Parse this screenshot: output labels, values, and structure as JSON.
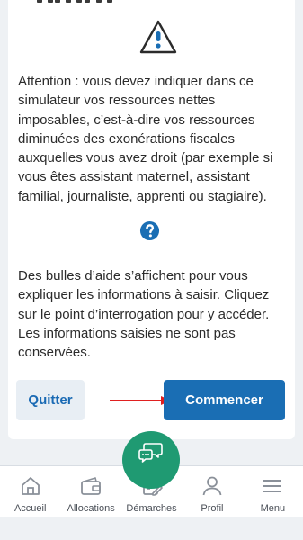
{
  "warning_text": "Attention : vous devez indiquer dans ce simulateur vos ressources nettes imposables, c’est-à-dire vos ressources diminuées des exonérations fiscales auxquelles vous avez droit (par exemple si vous êtes assistant maternel, assistant familial, journaliste, apprenti ou stagiaire).",
  "help_text_line1": "Des bulles d’aide s’affichent pour vous expliquer les informations à saisir. Cliquez sur le point d’interrogation pour y accéder.",
  "help_text_line2": "Les informations saisies ne sont pas conservées.",
  "buttons": {
    "quit": "Quitter",
    "start": "Commencer"
  },
  "nav": [
    {
      "label": "Accueil",
      "icon": "home-icon"
    },
    {
      "label": "Allocations",
      "icon": "wallet-icon"
    },
    {
      "label": "Démarches",
      "icon": "document-edit-icon"
    },
    {
      "label": "Profil",
      "icon": "user-icon"
    },
    {
      "label": "Menu",
      "icon": "hamburger-menu-icon"
    }
  ],
  "colors": {
    "primary": "#1a6eb4",
    "accent_green": "#1f9a72",
    "arrow_red": "#e02020",
    "icon_gray": "#8a9099"
  }
}
